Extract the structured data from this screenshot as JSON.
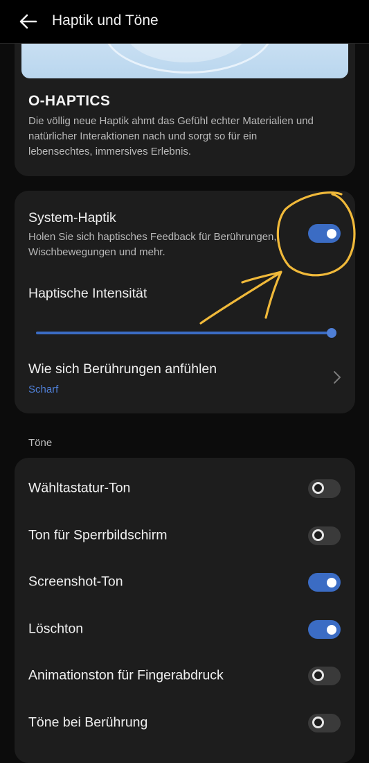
{
  "header": {
    "title": "Haptik und Töne",
    "back_icon": "arrow-left-icon"
  },
  "ohaptics": {
    "title": "O-HAPTICS",
    "description": "Die völlig neue Haptik ahmt das Gefühl echter Materialien und natürlicher Interaktionen nach und sorgt so für ein lebensechtes, immersives Erlebnis."
  },
  "haptics": {
    "system_haptik": {
      "title": "System-Haptik",
      "subtitle": "Holen Sie sich haptisches Feedback für Berührungen, Wischbewegungen und mehr.",
      "enabled": true
    },
    "intensity": {
      "title": "Haptische Intensität",
      "level": 1.0
    },
    "touch_feel": {
      "title": "Wie sich Berührungen anfühlen",
      "value": "Scharf",
      "icon": "chevron-right-icon"
    }
  },
  "tones": {
    "section_label": "Töne",
    "items": [
      {
        "label": "Wähltastatur-Ton",
        "enabled": false
      },
      {
        "label": "Ton für Sperrbildschirm",
        "enabled": false
      },
      {
        "label": "Screenshot-Ton",
        "enabled": true
      },
      {
        "label": "Löschton",
        "enabled": true
      },
      {
        "label": "Animationston für Fingerabdruck",
        "enabled": false
      },
      {
        "label": "Töne bei Berührung",
        "enabled": false
      }
    ]
  },
  "colors": {
    "accent": "#3b6cc4",
    "annotation": "#f0b93a",
    "background": "#0c0c0c",
    "card": "#1d1d1d"
  }
}
